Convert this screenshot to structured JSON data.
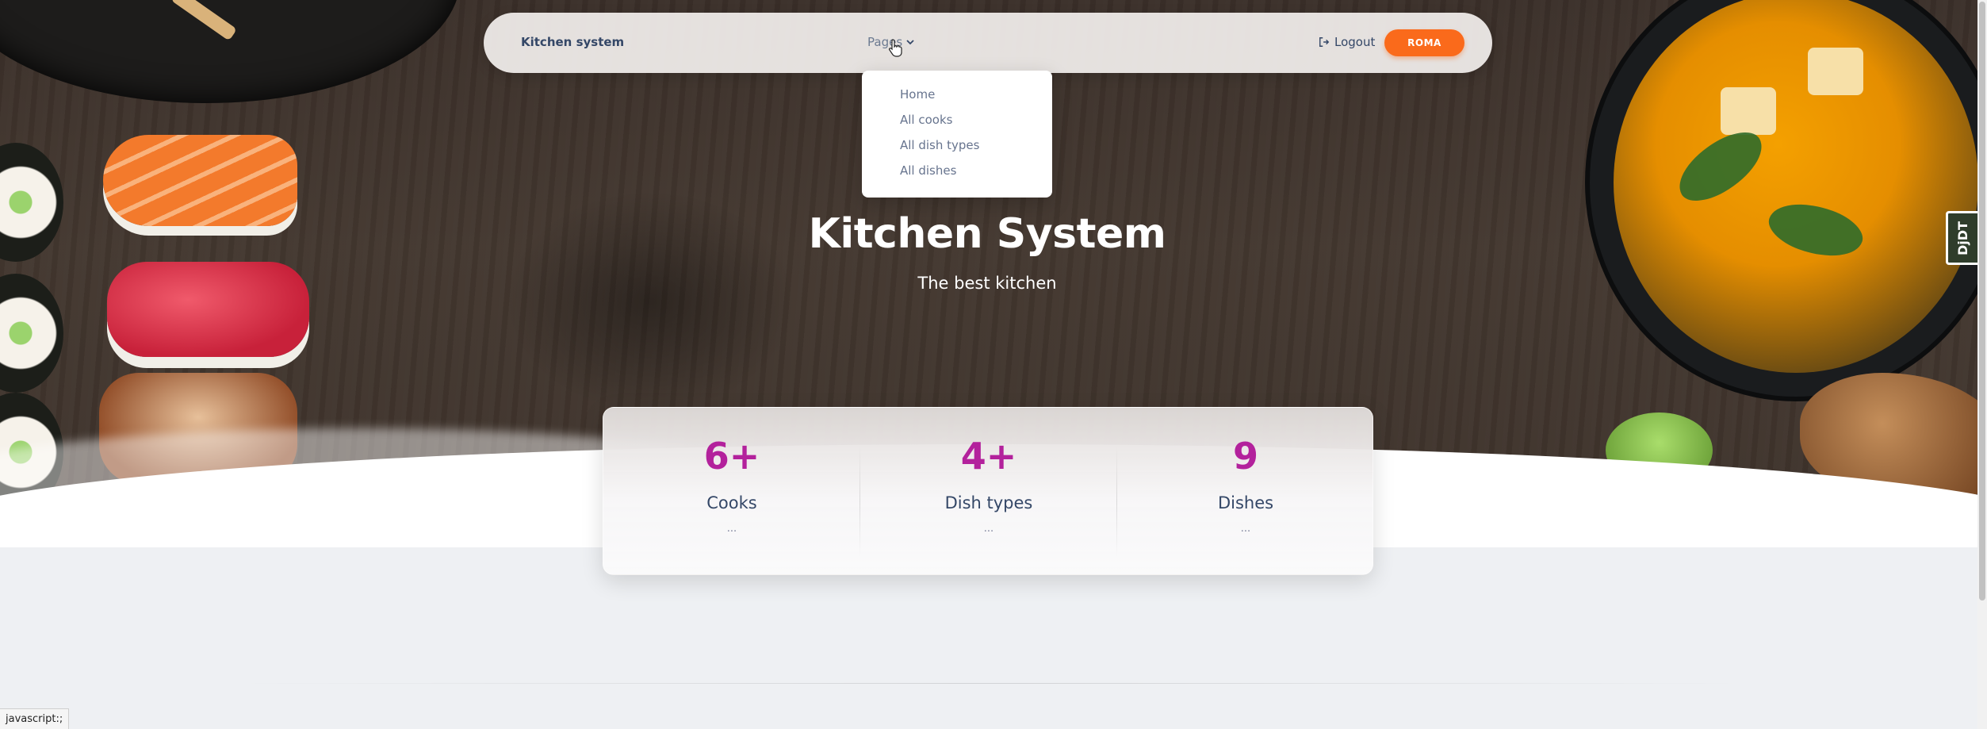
{
  "navbar": {
    "brand": "Kitchen system",
    "pages_label": "Pages",
    "logout_label": "Logout",
    "user_label": "ROMA"
  },
  "dropdown": {
    "items": [
      "Home",
      "All cooks",
      "All dish types",
      "All dishes"
    ]
  },
  "hero": {
    "title": "Kitchen System",
    "subtitle": "The best kitchen"
  },
  "stats": [
    {
      "value": "6+",
      "label": "Cooks",
      "desc": "..."
    },
    {
      "value": "4+",
      "label": "Dish types",
      "desc": "..."
    },
    {
      "value": "9",
      "label": "Dishes",
      "desc": "..."
    }
  ],
  "debug_toolbar": {
    "label": "DjDT"
  },
  "statusbar": {
    "text": "javascript:;"
  },
  "colors": {
    "accent": "#fa6a1b",
    "stat_number": "#b3219c",
    "heading": "#344767",
    "muted": "#67748e"
  }
}
